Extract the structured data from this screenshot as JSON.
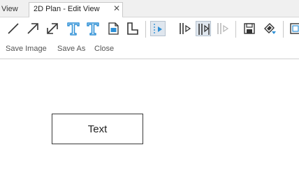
{
  "tabs": [
    {
      "label": "View"
    },
    {
      "label": "2D Plan - Edit View",
      "close": "✕"
    }
  ],
  "toolbar": {
    "tools": [
      {
        "icon": "line-icon"
      },
      {
        "icon": "arrow-icon"
      },
      {
        "icon": "double-arrow-icon"
      },
      {
        "icon": "text-icon"
      },
      {
        "icon": "text-alt-icon"
      },
      {
        "icon": "image-icon"
      },
      {
        "icon": "dimension-icon"
      },
      {
        "icon": "select-pointer-icon",
        "pressed": true
      },
      {
        "icon": "align-left-icon"
      },
      {
        "icon": "align-center-icon",
        "pressed": true
      },
      {
        "icon": "align-right-icon"
      },
      {
        "icon": "save-image-icon"
      },
      {
        "icon": "save-as-icon"
      },
      {
        "icon": "close-icon"
      }
    ],
    "links": {
      "save_image": "Save Image",
      "save_as": "Save As",
      "close": "Close"
    }
  },
  "canvas": {
    "textbox_label": "Text"
  },
  "colors": {
    "accent": "#2d8fd5",
    "icon_dark": "#333333",
    "tab_bg": "#f0f0f0"
  }
}
